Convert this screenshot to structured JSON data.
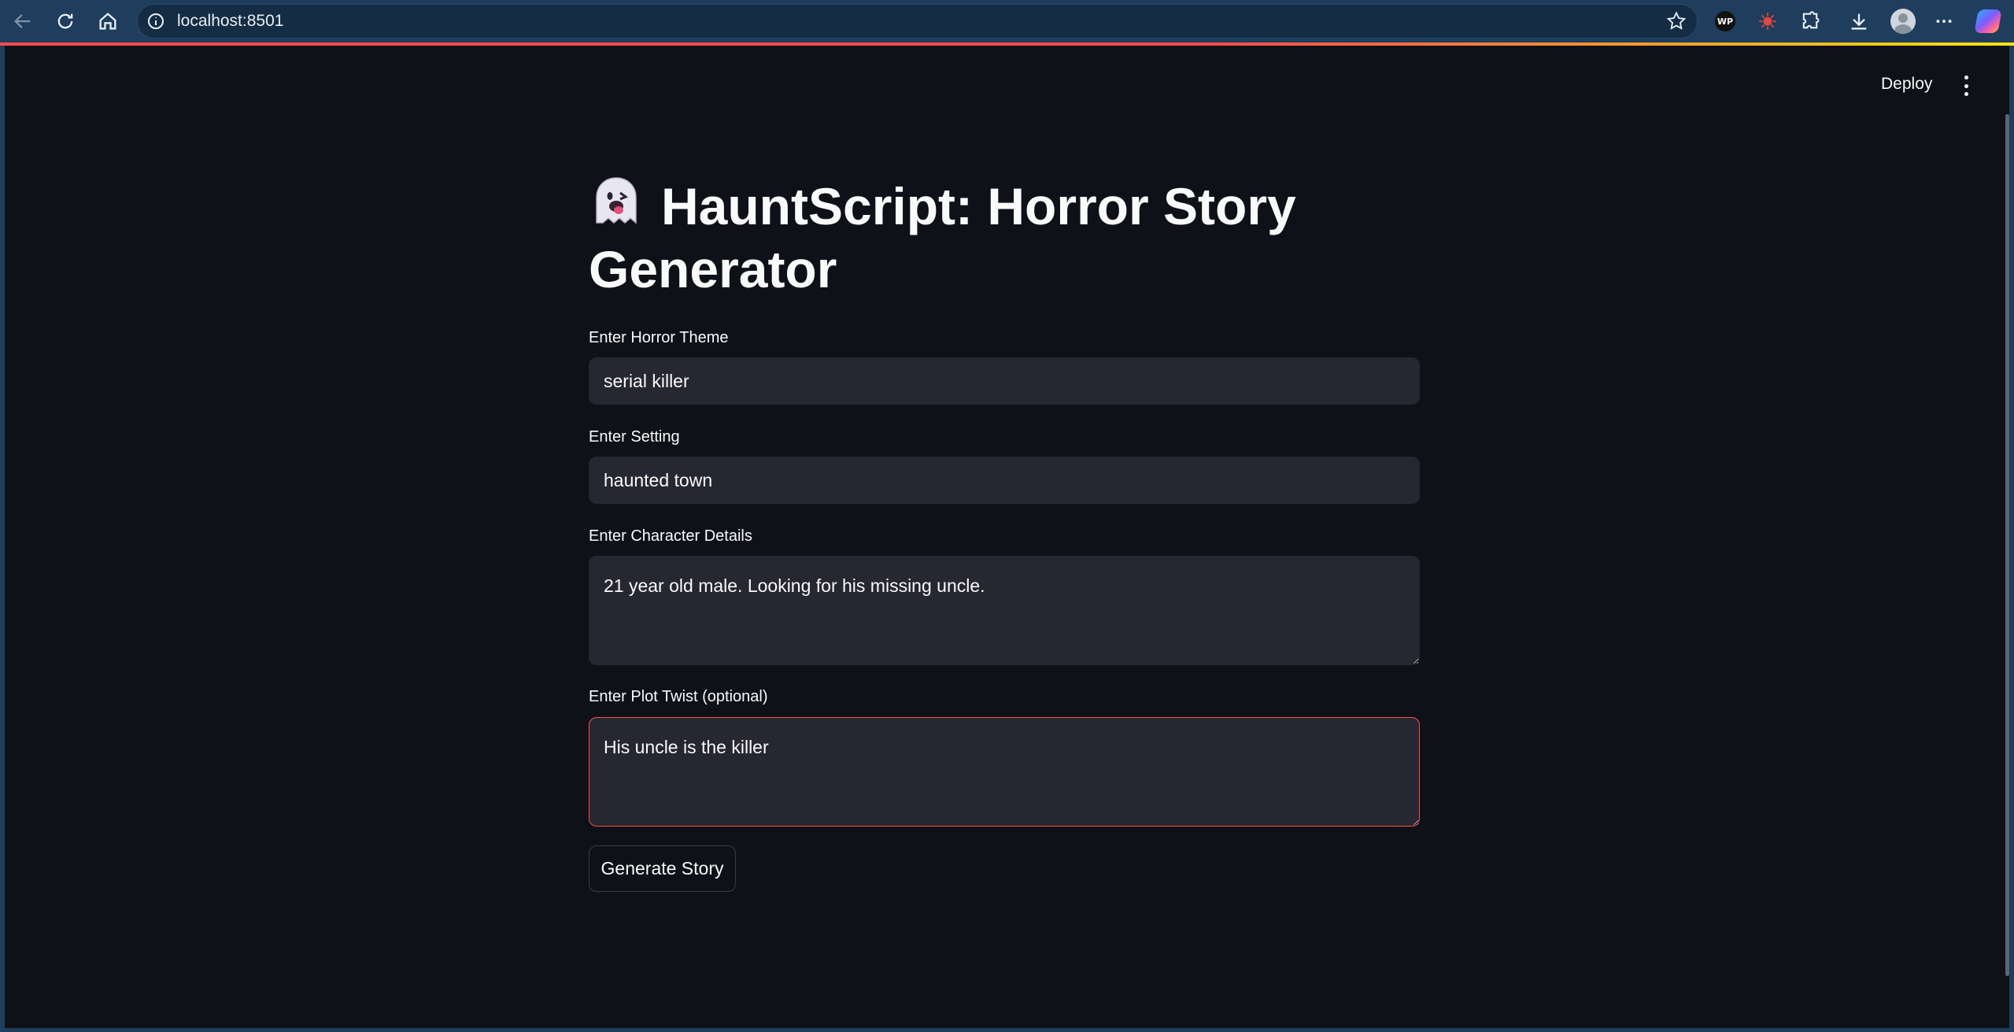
{
  "browser": {
    "url": "localhost:8501",
    "extensions": {
      "wp_badge_label": "WP"
    }
  },
  "app": {
    "header": {
      "deploy_label": "Deploy"
    },
    "title_emoji": "ghost",
    "title": "HauntScript: Horror Story Generator",
    "fields": {
      "theme": {
        "label": "Enter Horror Theme",
        "value": "serial killer"
      },
      "setting": {
        "label": "Enter Setting",
        "value": "haunted town"
      },
      "character": {
        "label": "Enter Character Details",
        "value": "21 year old male. Looking for his missing uncle."
      },
      "twist": {
        "label": "Enter Plot Twist (optional)",
        "value": "His uncle is the killer\n"
      }
    },
    "generate_button": "Generate Story"
  },
  "colors": {
    "background": "#0e1117",
    "input_bg": "#262730",
    "focus_border": "#ff4b4b",
    "chrome": "#1f3d5c"
  }
}
